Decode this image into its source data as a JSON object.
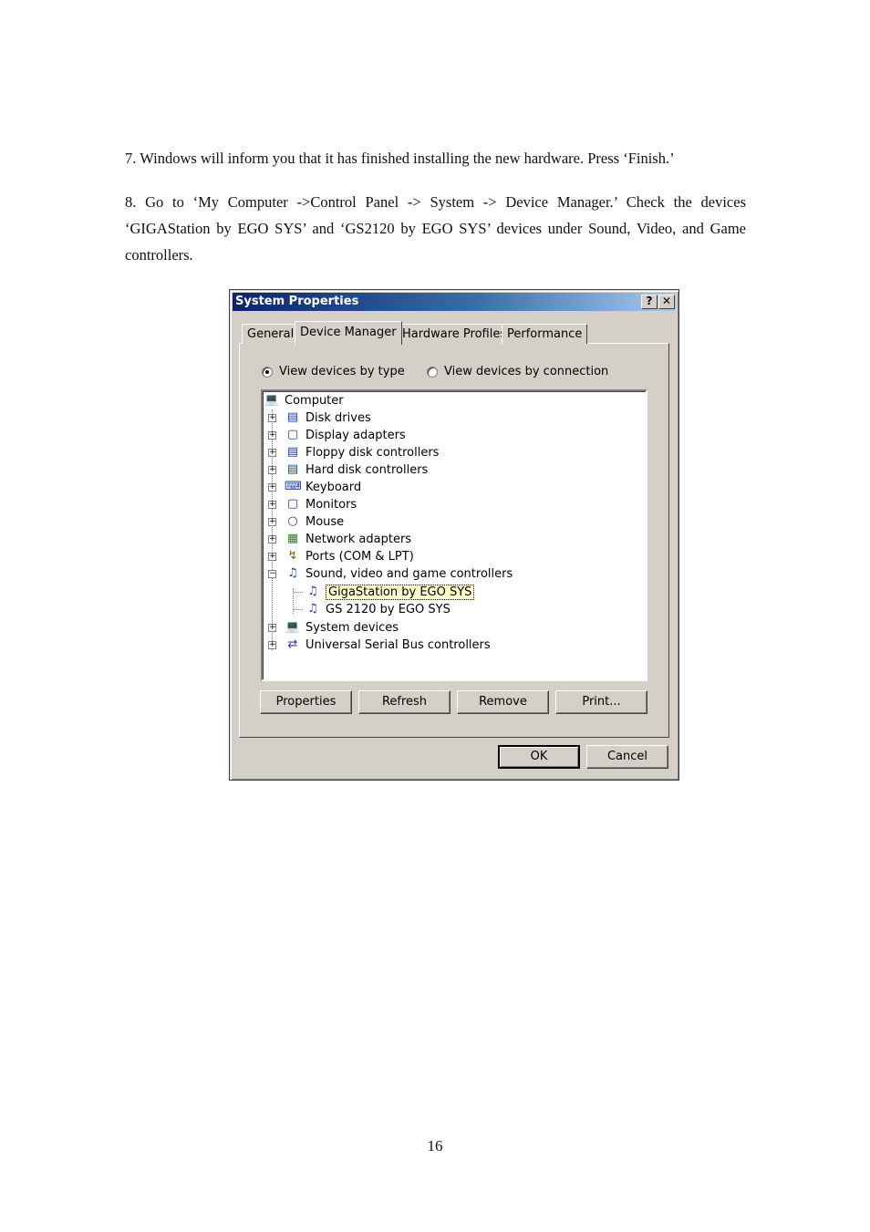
{
  "doc": {
    "step7": "7. Windows will inform you that it has finished installing the new hardware. Press ‘Finish.’",
    "step8": "8. Go to ‘My Computer ->Control Panel -> System -> Device Manager.’ Check the devices ‘GIGAStation by EGO SYS’ and ‘GS2120 by EGO SYS’ devices under Sound, Video, and Game controllers.",
    "page_number": "16"
  },
  "dialog": {
    "title": "System Properties",
    "help_glyph": "?",
    "close_glyph": "✕",
    "tabs": [
      "General",
      "Device Manager",
      "Hardware Profiles",
      "Performance"
    ],
    "selected_tab": "Device Manager",
    "radio_by_type": "View devices by type",
    "radio_by_connection": "View devices by connection",
    "radio_selected": "View devices by type",
    "tree": {
      "root": "Computer",
      "items": [
        {
          "label": "Disk drives",
          "icon": "disk-drive-icon"
        },
        {
          "label": "Display adapters",
          "icon": "display-adapter-icon"
        },
        {
          "label": "Floppy disk controllers",
          "icon": "floppy-controller-icon"
        },
        {
          "label": "Hard disk controllers",
          "icon": "hard-disk-controller-icon"
        },
        {
          "label": "Keyboard",
          "icon": "keyboard-icon"
        },
        {
          "label": "Monitors",
          "icon": "monitor-icon"
        },
        {
          "label": "Mouse",
          "icon": "mouse-icon"
        },
        {
          "label": "Network adapters",
          "icon": "network-adapter-icon"
        },
        {
          "label": "Ports (COM & LPT)",
          "icon": "port-icon"
        },
        {
          "label": "Sound, video and game controllers",
          "icon": "sound-controller-icon"
        },
        {
          "label": "System devices",
          "icon": "system-device-icon"
        },
        {
          "label": "Universal Serial Bus controllers",
          "icon": "usb-icon"
        }
      ],
      "sound_children": [
        "GigaStation by EGO SYS",
        "GS 2120 by EGO SYS"
      ],
      "selected_child": "GigaStation by EGO SYS"
    },
    "buttons": {
      "properties": "Properties",
      "refresh": "Refresh",
      "remove": "Remove",
      "print": "Print...",
      "ok": "OK",
      "cancel": "Cancel"
    }
  }
}
